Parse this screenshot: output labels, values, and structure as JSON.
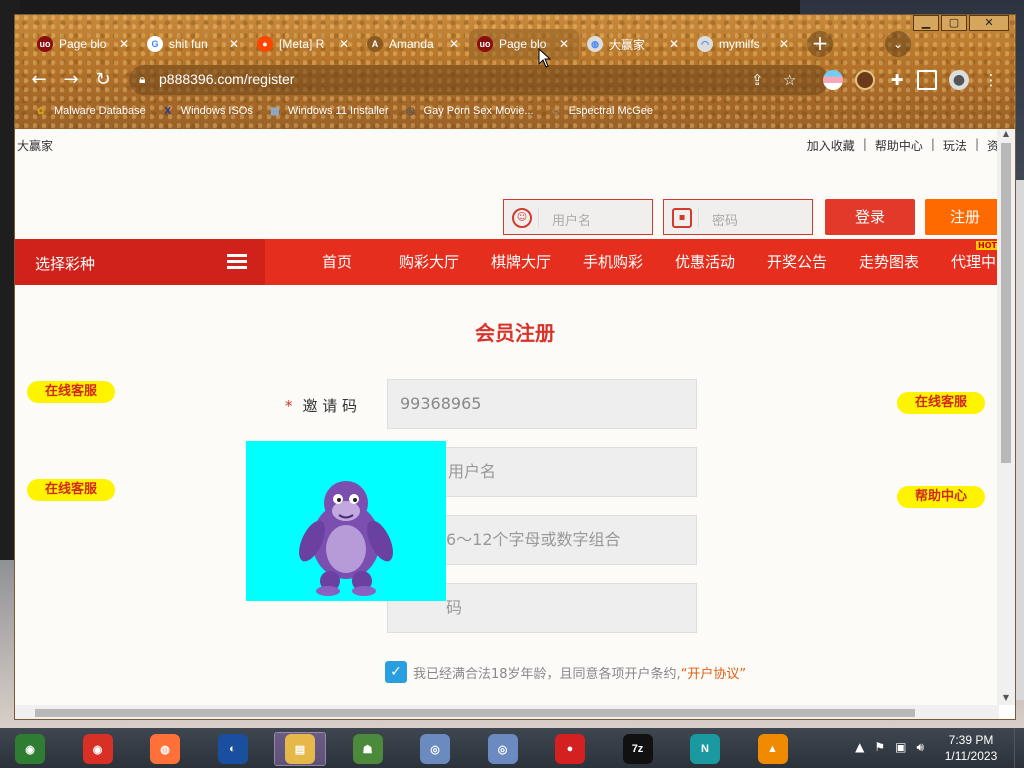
{
  "browser": {
    "tabs": [
      {
        "title": "Page blo",
        "favicon": "ublock-icon",
        "color": "#8b0d0d",
        "glyph": "uo"
      },
      {
        "title": "shit fun",
        "favicon": "google-icon",
        "color": "#ffffff",
        "glyph": "G"
      },
      {
        "title": "[Meta] R",
        "favicon": "reddit-icon",
        "color": "#ff4500",
        "glyph": "●"
      },
      {
        "title": "Amanda",
        "favicon": "amazon-a-icon",
        "color": "#8a5a20",
        "glyph": "A"
      },
      {
        "title": "Page blo",
        "favicon": "ublock-icon",
        "color": "#8b0d0d",
        "glyph": "uo"
      },
      {
        "title": "大赢家",
        "favicon": "globe-icon",
        "color": "#dddddd",
        "glyph": "◍"
      },
      {
        "title": "mymilfs",
        "favicon": "loading-icon",
        "color": "#dddddd",
        "glyph": "◠"
      }
    ],
    "active_tab_index": 4,
    "url": "p888396.com/register",
    "bookmarks": [
      {
        "label": "Malware Database",
        "icon": "bookmark-folder-icon",
        "glyph": "✿",
        "color": "#d4a020"
      },
      {
        "label": "Windows ISOs",
        "icon": "x-icon",
        "glyph": "X",
        "color": "#1a3aa0"
      },
      {
        "label": "Windows 11 Installer",
        "icon": "installer-icon",
        "glyph": "▦",
        "color": "#8ab0d0"
      },
      {
        "label": "Gay Porn Sex Movie...",
        "icon": "site-icon",
        "glyph": "◎",
        "color": "#555555"
      },
      {
        "label": "Espectral McGee",
        "icon": "face-icon",
        "glyph": "☺",
        "color": "#c0a080"
      }
    ]
  },
  "site": {
    "name": "大赢家",
    "top_links": [
      "加入收藏",
      "帮助中心",
      "玩法",
      "资"
    ],
    "username_placeholder": "用户名",
    "password_placeholder": "密码",
    "login_label": "登录",
    "register_label": "注册",
    "nav_select": "选择彩种",
    "nav_items": [
      "首页",
      "购彩大厅",
      "棋牌大厅",
      "手机购彩",
      "优惠活动",
      "开奖公告",
      "走势图表",
      "代理中心"
    ],
    "hot_badge": "HOT",
    "form_title": "会员注册",
    "cs_left_top": "在线客服",
    "cs_left_bottom": "在线客服",
    "cs_right_top": "在线客服",
    "cs_right_bottom": "帮助中心",
    "invite_label": "邀 请 码",
    "invite_value": "99368965",
    "field_username_placeholder": "用户名",
    "field_password_placeholder": "6～12个字母或数字组合",
    "field_confirm_placeholder": "码",
    "agree_text": "我已经满合法18岁年龄，且同意各项开户条约,",
    "agree_link": "“开户协议”"
  },
  "taskbar": {
    "apps": [
      {
        "name": "chrome-canary-icon",
        "glyph": "◉",
        "color": "#2e7d32"
      },
      {
        "name": "chrome-icon",
        "glyph": "◉",
        "color": "#d93025"
      },
      {
        "name": "firefox-icon",
        "glyph": "◍",
        "color": "#ff7139"
      },
      {
        "name": "obama-icon",
        "glyph": "◐",
        "color": "#1a4fa0"
      },
      {
        "name": "file-explorer-icon",
        "glyph": "▤",
        "color": "#e6b84a"
      },
      {
        "name": "network-users-icon",
        "glyph": "☗",
        "color": "#4a8a3a"
      },
      {
        "name": "installer-cd-icon",
        "glyph": "◎",
        "color": "#6a8ac0"
      },
      {
        "name": "installer-cd-2-icon",
        "glyph": "◎",
        "color": "#6a8ac0"
      },
      {
        "name": "angry-birds-icon",
        "glyph": "●",
        "color": "#d42020"
      },
      {
        "name": "7zip-icon",
        "glyph": "7z",
        "color": "#111111"
      },
      {
        "name": "n-shield-icon",
        "glyph": "N",
        "color": "#1a9aa0"
      },
      {
        "name": "vlc-icon",
        "glyph": "▲",
        "color": "#f08a00"
      }
    ],
    "time": "7:39 PM",
    "date": "1/11/2023"
  }
}
